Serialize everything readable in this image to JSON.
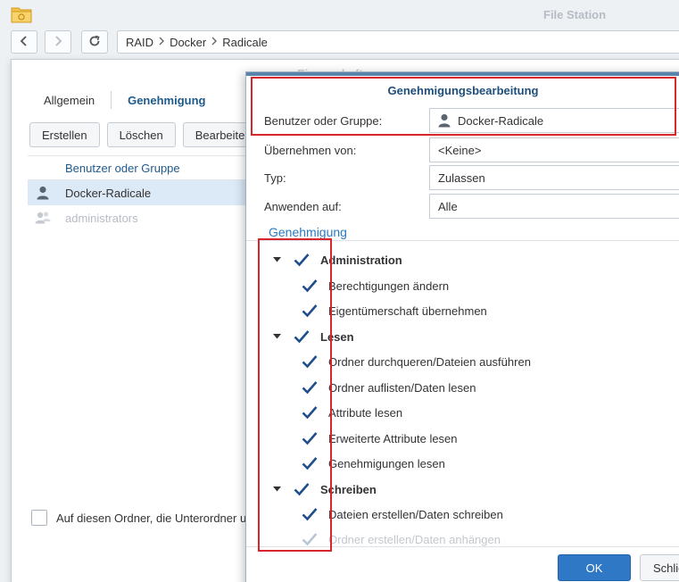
{
  "app": {
    "title": "File Station",
    "icon": "folder-icon"
  },
  "navbar": {
    "back_icon": "chevron-left-icon",
    "forward_icon": "chevron-right-icon",
    "refresh_icon": "refresh-icon",
    "path": [
      "RAID",
      "Docker",
      "Radicale"
    ]
  },
  "properties": {
    "title": "Eigenschaften",
    "tabs": [
      {
        "label": "Allgemein",
        "active": false
      },
      {
        "label": "Genehmigung",
        "active": true
      }
    ],
    "buttons": [
      "Erstellen",
      "Löschen",
      "Bearbeiten"
    ],
    "list_header": "Benutzer oder Gruppe",
    "list_rows": [
      {
        "name": "Docker-Radicale",
        "icon": "user-icon",
        "selected": true
      },
      {
        "name": "administrators",
        "icon": "group-icon",
        "selected": false
      }
    ],
    "apply_checkbox_label": "Auf diesen Ordner, die Unterordner und Dateien anwenden"
  },
  "permission_dialog": {
    "title": "Genehmigungsbearbeitung",
    "fields": [
      {
        "label": "Benutzer oder Gruppe:",
        "value": "Docker-Radicale",
        "icon": "user-icon"
      },
      {
        "label": "Übernehmen von:",
        "value": "<Keine>"
      },
      {
        "label": "Typ:",
        "value": "Zulassen"
      },
      {
        "label": "Anwenden auf:",
        "value": "Alle"
      }
    ],
    "section_title": "Genehmigung",
    "groups": [
      {
        "label": "Administration",
        "checked": true,
        "items": [
          {
            "label": "Berechtigungen ändern",
            "checked": true
          },
          {
            "label": "Eigentümerschaft übernehmen",
            "checked": true
          }
        ]
      },
      {
        "label": "Lesen",
        "checked": true,
        "items": [
          {
            "label": "Ordner durchqueren/Dateien ausführen",
            "checked": true
          },
          {
            "label": "Ordner auflisten/Daten lesen",
            "checked": true
          },
          {
            "label": "Attribute lesen",
            "checked": true
          },
          {
            "label": "Erweiterte Attribute lesen",
            "checked": true
          },
          {
            "label": "Genehmigungen lesen",
            "checked": true
          }
        ]
      },
      {
        "label": "Schreiben",
        "checked": true,
        "items": [
          {
            "label": "Dateien erstellen/Daten schreiben",
            "checked": true
          },
          {
            "label": "Ordner erstellen/Daten anhängen",
            "checked": true
          }
        ]
      }
    ],
    "ok_label": "OK",
    "close_label": "Schließen"
  },
  "colors": {
    "accent": "#2f78c5",
    "highlight_box": "#d9262c",
    "section_blue": "#2a7ac0"
  }
}
